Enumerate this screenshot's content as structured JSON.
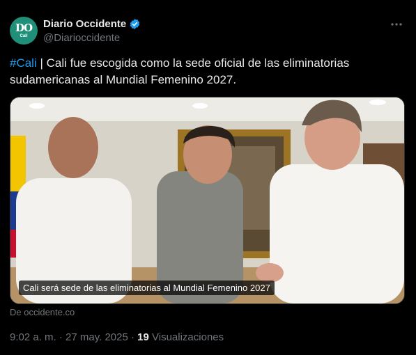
{
  "author": {
    "avatar_letters": "DO",
    "avatar_sub": "Cali",
    "name": "Diario Occidente",
    "handle": "@Diarioccidente",
    "verified_color": "#1d9bf0"
  },
  "tweet": {
    "hashtag": "#Cali",
    "text": " | Cali fue escogida como la sede oficial de las eliminatorias sudamericanas al Mundial Femenino 2027."
  },
  "media": {
    "caption": "Cali será sede de las eliminatorias al Mundial Femenino 2027",
    "source": "De occidente.co"
  },
  "meta": {
    "time_date": "9:02 a. m. · 27 may. 2025 · ",
    "views_count": "19",
    "views_label": " Visualizaciones"
  },
  "colors": {
    "background": "#000000",
    "text": "#e7e9ea",
    "secondary": "#71767b",
    "link": "#1d9bf0"
  }
}
